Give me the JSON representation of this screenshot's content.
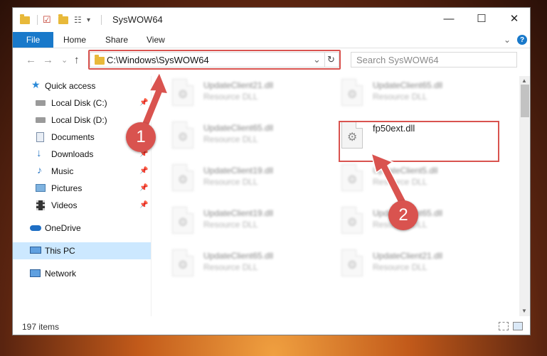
{
  "window": {
    "title": "SysWOW64",
    "minimize_glyph": "—",
    "maximize_glyph": "☐",
    "close_glyph": "✕"
  },
  "ribbon": {
    "tabs": [
      {
        "label": "File"
      },
      {
        "label": "Home"
      },
      {
        "label": "Share"
      },
      {
        "label": "View"
      }
    ],
    "collapse_glyph": "⌄",
    "help_glyph": "?"
  },
  "address": {
    "path": "C:\\Windows\\SysWOW64",
    "dropdown_glyph": "⌄",
    "refresh_glyph": "↻"
  },
  "search": {
    "placeholder": "Search SysWOW64"
  },
  "nav": {
    "back_glyph": "←",
    "forward_glyph": "→",
    "recent_glyph": "⌄",
    "up_glyph": "↑",
    "items": [
      {
        "label": "Quick access",
        "icon": "star-icon"
      },
      {
        "label": "Local Disk (C:)",
        "icon": "drive-icon"
      },
      {
        "label": "Local Disk (D:)",
        "icon": "drive-icon"
      },
      {
        "label": "Documents",
        "icon": "documents-icon"
      },
      {
        "label": "Downloads",
        "icon": "download-icon"
      },
      {
        "label": "Music",
        "icon": "music-icon"
      },
      {
        "label": "Pictures",
        "icon": "pictures-icon"
      },
      {
        "label": "Videos",
        "icon": "videos-icon"
      },
      {
        "label": "OneDrive",
        "icon": "cloud-icon"
      },
      {
        "label": "This PC",
        "icon": "computer-icon"
      },
      {
        "label": "Network",
        "icon": "network-icon"
      }
    ]
  },
  "files": [
    {
      "name": "UpdateClient21.dll",
      "type": "Resource DLL"
    },
    {
      "name": "UpdateClient65.dll",
      "type": "Resource DLL"
    },
    {
      "name": "UpdateClient65.dll",
      "type": "Resource DLL"
    },
    {
      "name": "fp50ext.dll",
      "type": ""
    },
    {
      "name": "UpdateClient19.dll",
      "type": "Resource DLL"
    },
    {
      "name": "UpdateClient5.dll",
      "type": "Resource DLL"
    },
    {
      "name": "UpdateClient19.dll",
      "type": "Resource DLL"
    },
    {
      "name": "UpdateClient65.dll",
      "type": "Resource DLL"
    },
    {
      "name": "UpdateClient65.dll",
      "type": "Resource DLL"
    },
    {
      "name": "UpdateClient21.dll",
      "type": "Resource DLL"
    }
  ],
  "status": {
    "item_count": "197 items"
  },
  "annotations": {
    "step1": "1",
    "step2": "2",
    "color": "#d9534f"
  }
}
